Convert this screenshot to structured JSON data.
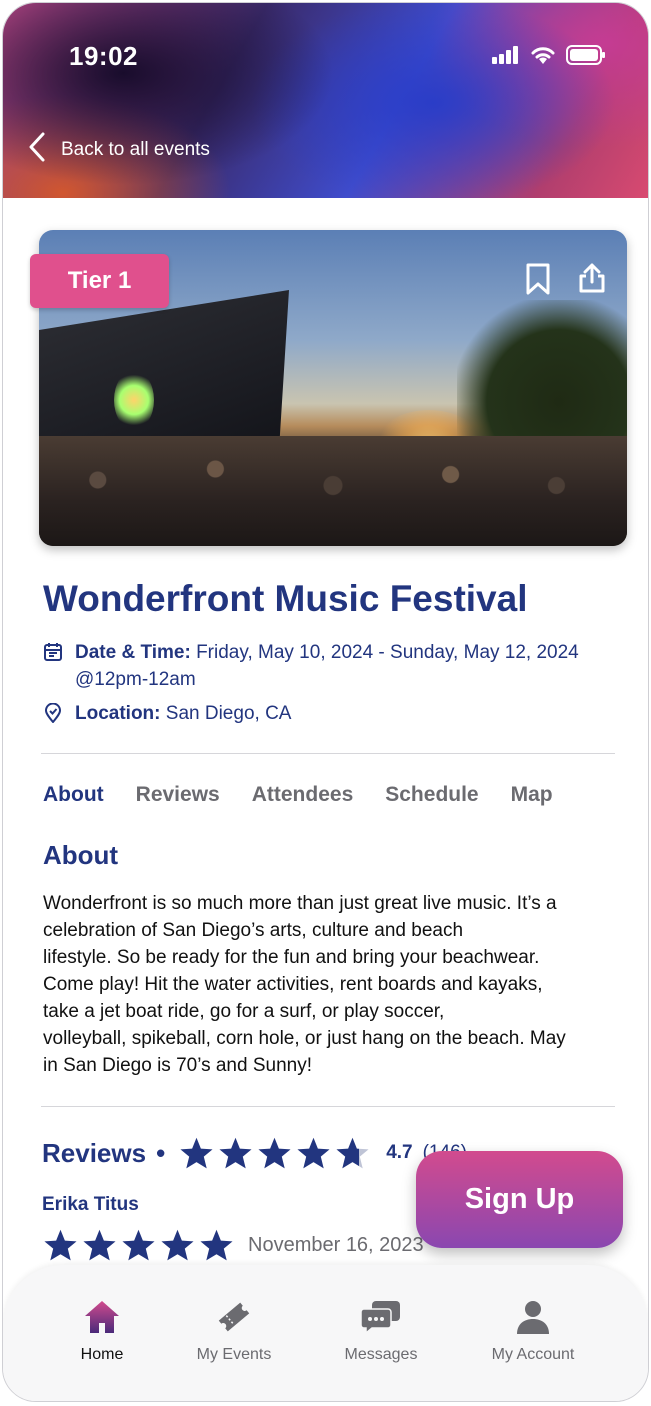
{
  "status_bar": {
    "time": "19:02"
  },
  "nav": {
    "back_label": "Back to all events"
  },
  "event": {
    "tier": "Tier 1",
    "title": "Wonderfront Music Festival",
    "date_label": "Date & Time:",
    "date_value": "Friday, May 10, 2024 - Sunday, May 12, 2024",
    "time_value": "@12pm-12am",
    "location_label": "Location:",
    "location_value": "San Diego, CA"
  },
  "tabs": [
    {
      "label": "About",
      "active": true
    },
    {
      "label": "Reviews",
      "active": false
    },
    {
      "label": "Attendees",
      "active": false
    },
    {
      "label": "Schedule",
      "active": false
    },
    {
      "label": "Map",
      "active": false
    }
  ],
  "about": {
    "title": "About",
    "lines": [
      "Wonderfront is so much more than just great live music. It’s a",
      "celebration of San Diego’s arts, culture and beach",
      "lifestyle.  So be ready for the fun and bring your beachwear.",
      "Come play! Hit the water activities, rent boards and kayaks,",
      "take a jet boat ride, go for a surf, or play soccer,",
      "volleyball, spikeball, corn hole, or just hang on the beach. May",
      "in San Diego is 70’s and Sunny!"
    ]
  },
  "reviews": {
    "title": "Reviews",
    "separator": "•",
    "rating": "4.7",
    "rating_value": 4.7,
    "count": "(146)",
    "items": [
      {
        "name": "Erika Titus",
        "stars": 5,
        "date": "November 16, 2023"
      }
    ]
  },
  "cta": {
    "label": "Sign Up"
  },
  "tabbar": [
    {
      "label": "Home",
      "icon": "home-icon",
      "active": true
    },
    {
      "label": "My Events",
      "icon": "ticket-icon",
      "active": false
    },
    {
      "label": "Messages",
      "icon": "chat-icon",
      "active": false
    },
    {
      "label": "My Account",
      "icon": "user-icon",
      "active": false
    }
  ],
  "colors": {
    "primary": "#22357f",
    "accent_pink": "#e0508d",
    "cta_gradient_start": "#d24b8e",
    "cta_gradient_end": "#8a47b0",
    "muted": "#6b6b70"
  }
}
